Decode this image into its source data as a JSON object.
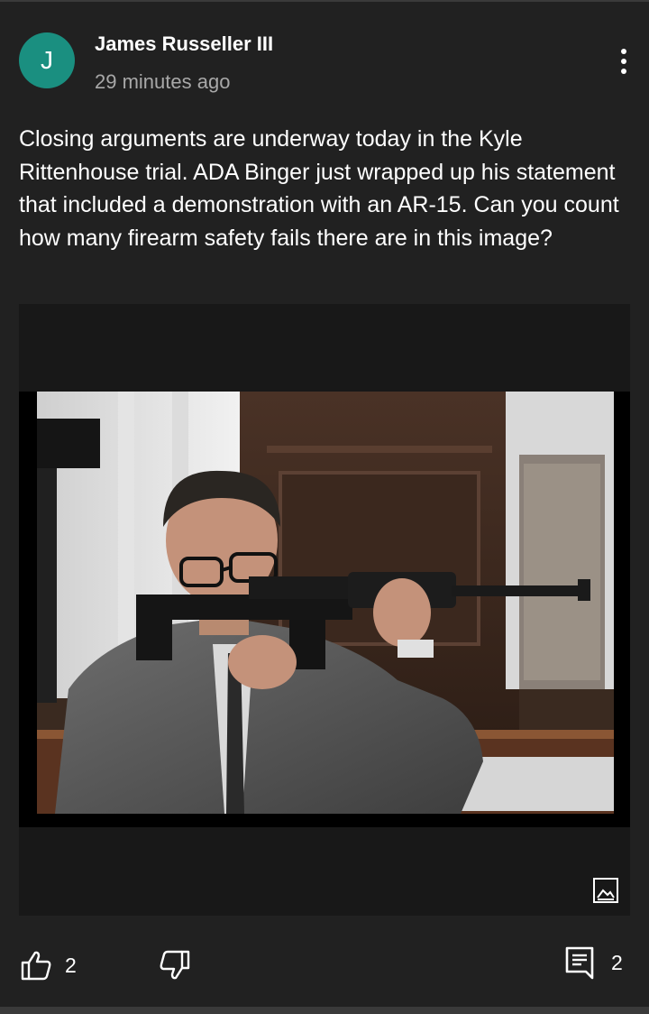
{
  "post": {
    "author": "James Russeller III",
    "avatar_letter": "J",
    "avatar_color": "#1a8f80",
    "timestamp": "29 minutes ago",
    "text": "Closing arguments are underway today in the Kyle Rittenhouse trial. ADA Binger just wrapped up his statement that included a demonstration with an AR-15. Can you count how many firearm safety fails there are in this image?"
  },
  "media": {
    "icon": "image-icon"
  },
  "actions": {
    "like_icon": "thumbs-up-icon",
    "like_count": "2",
    "dislike_icon": "thumbs-down-icon",
    "comment_icon": "comment-icon",
    "comment_count": "2",
    "more_icon": "more-vertical-icon"
  }
}
